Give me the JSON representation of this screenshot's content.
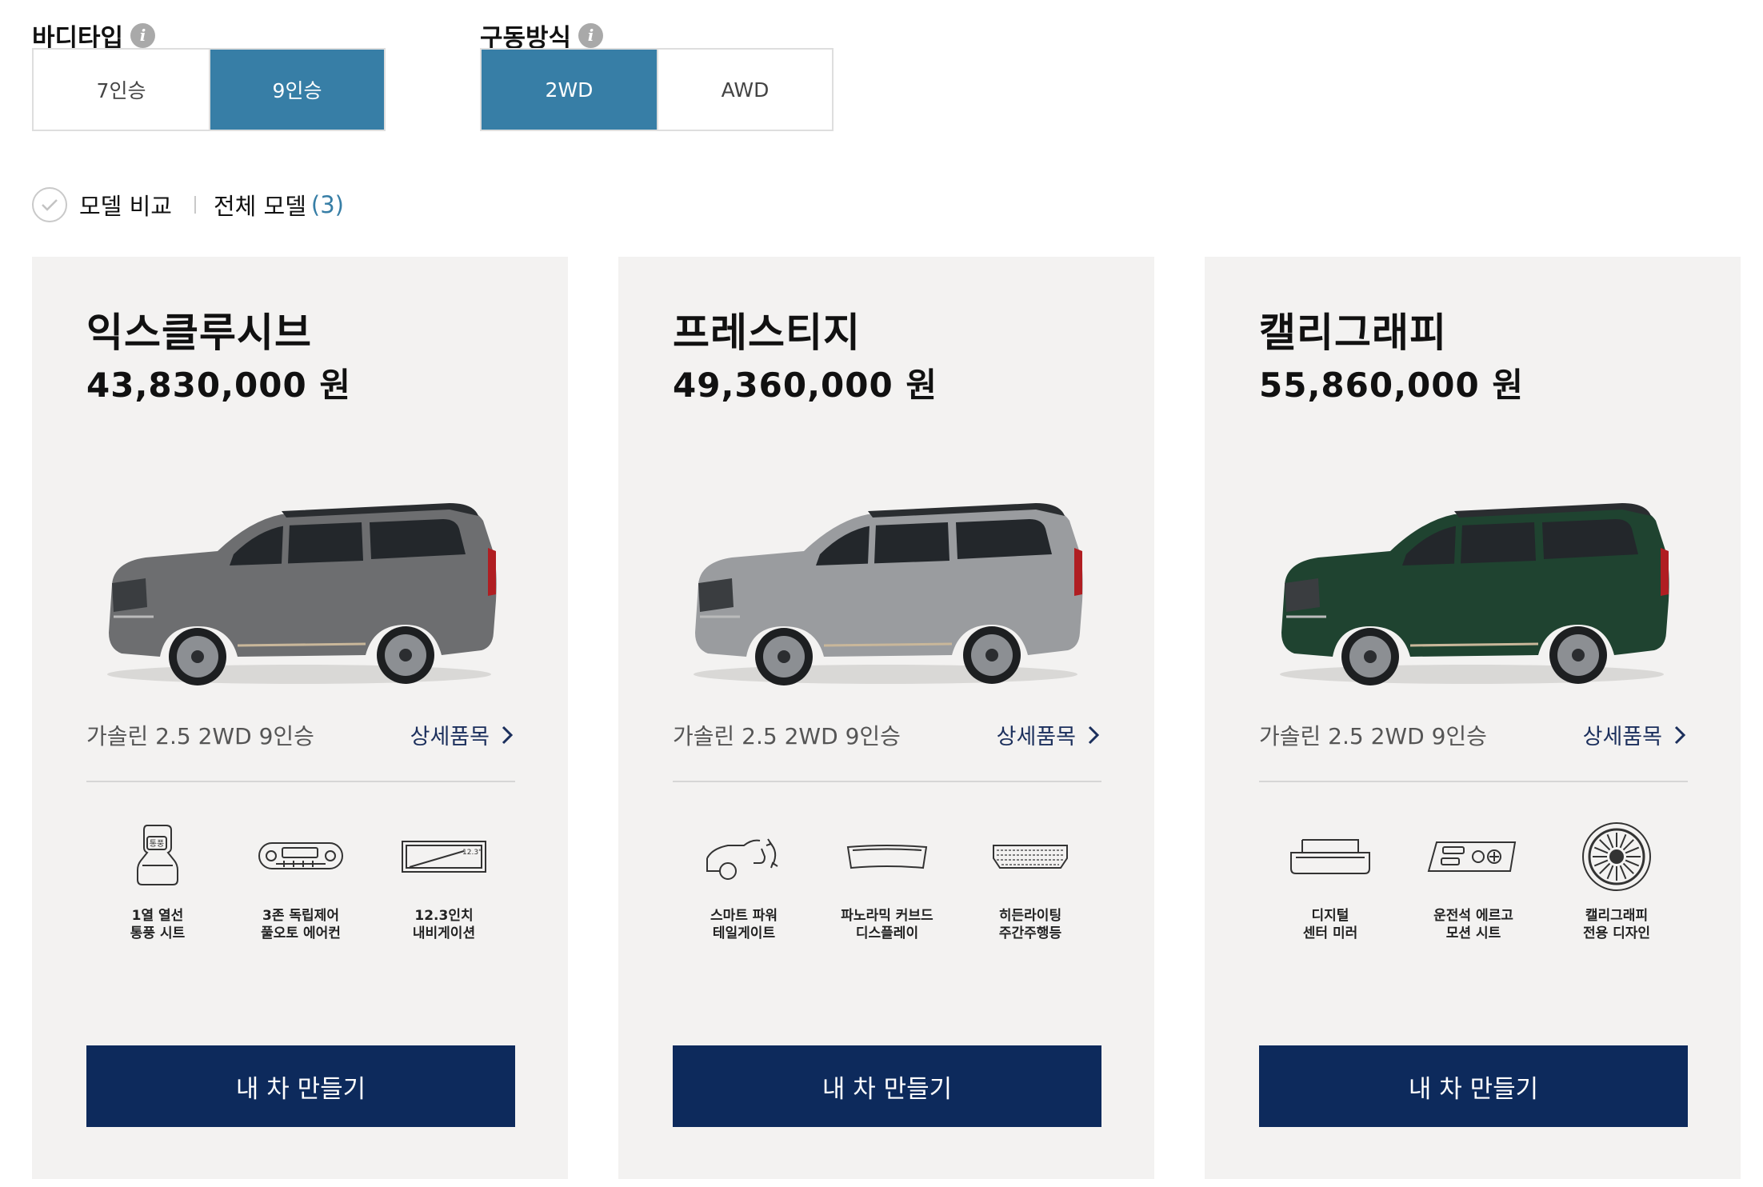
{
  "filters": {
    "body_type": {
      "title": "바디타입",
      "options": [
        {
          "label": "7인승",
          "selected": false
        },
        {
          "label": "9인승",
          "selected": true
        }
      ]
    },
    "drive_type": {
      "title": "구동방식",
      "options": [
        {
          "label": "2WD",
          "selected": true
        },
        {
          "label": "AWD",
          "selected": false
        }
      ]
    }
  },
  "compare": {
    "label": "모델 비교",
    "all_models_label": "전체 모델",
    "all_models_count": "(3)"
  },
  "colors": {
    "accent_blue": "#377ea6",
    "navy": "#0d2a5c",
    "card_bg": "#f3f2f1"
  },
  "trims": [
    {
      "name": "익스클루시브",
      "price": "43,830,000 원",
      "car_color": "#6d6e70",
      "spec": "가솔린 2.5 2WD 9인승",
      "detail_label": "상세품목",
      "features": [
        {
          "icon": "heated-ventilated-seat-icon",
          "line1": "1열 열선",
          "line2": "통풍 시트"
        },
        {
          "icon": "climate-control-icon",
          "line1": "3존 독립제어",
          "line2": "풀오토 에어컨"
        },
        {
          "icon": "navigation-display-icon",
          "line1": "12.3인치",
          "line2": "내비게이션",
          "badge": "12.3\""
        }
      ],
      "button_label": "내 차 만들기"
    },
    {
      "name": "프레스티지",
      "price": "49,360,000 원",
      "car_color": "#9a9c9f",
      "spec": "가솔린 2.5 2WD 9인승",
      "detail_label": "상세품목",
      "features": [
        {
          "icon": "power-tailgate-icon",
          "line1": "스마트 파워",
          "line2": "테일게이트"
        },
        {
          "icon": "curved-display-icon",
          "line1": "파노라믹 커브드",
          "line2": "디스플레이"
        },
        {
          "icon": "hidden-lighting-icon",
          "line1": "히든라이팅",
          "line2": "주간주행등"
        }
      ],
      "button_label": "내 차 만들기"
    },
    {
      "name": "캘리그래피",
      "price": "55,860,000 원",
      "car_color": "#1f4330",
      "spec": "가솔린 2.5 2WD 9인승",
      "detail_label": "상세품목",
      "features": [
        {
          "icon": "digital-mirror-icon",
          "line1": "디지털",
          "line2": "센터 미러"
        },
        {
          "icon": "seat-control-panel-icon",
          "line1": "운전석 에르고",
          "line2": "모션 시트"
        },
        {
          "icon": "wheel-design-icon",
          "line1": "캘리그래피",
          "line2": "전용 디자인"
        }
      ],
      "button_label": "내 차 만들기"
    }
  ]
}
